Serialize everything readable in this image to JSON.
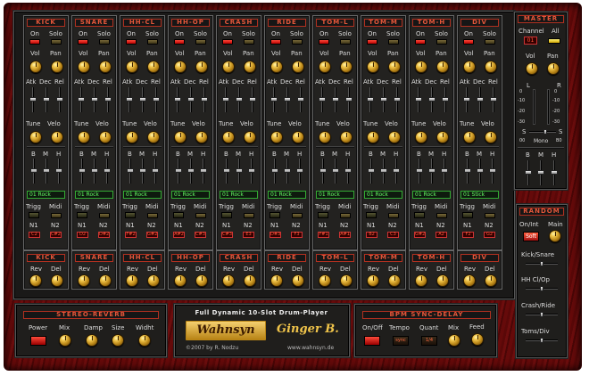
{
  "channels": [
    {
      "name": "KICK",
      "preset": "01 Rock",
      "n1": "C2",
      "n2": "C#2",
      "led_on": "red",
      "led_solo": "dark"
    },
    {
      "name": "SNARE",
      "preset": "01 Rock",
      "n1": "D2",
      "n2": "D#2",
      "led_on": "red",
      "led_solo": "dark"
    },
    {
      "name": "HH-CL",
      "preset": "01 Rock",
      "n1": "F#2",
      "n2": "G#2",
      "led_on": "red",
      "led_solo": "dark"
    },
    {
      "name": "HH-OP",
      "preset": "01 Rock",
      "n1": "A#2",
      "n2": "C#3",
      "led_on": "red",
      "led_solo": "dark"
    },
    {
      "name": "CRASH",
      "preset": "01 Rock",
      "n1": "C#3",
      "n2": "E3",
      "led_on": "red",
      "led_solo": "dark"
    },
    {
      "name": "RIDE",
      "preset": "01 Rock",
      "n1": "D#3",
      "n2": "F3",
      "led_on": "red",
      "led_solo": "dark"
    },
    {
      "name": "TOM-L",
      "preset": "01 Rock",
      "n1": "F#1",
      "n2": "A#1",
      "led_on": "red",
      "led_solo": "dark"
    },
    {
      "name": "TOM-M",
      "preset": "01 Rock",
      "n1": "B2",
      "n2": "C3",
      "led_on": "red",
      "led_solo": "dark"
    },
    {
      "name": "TOM-H",
      "preset": "01 Rock",
      "n1": "G#2",
      "n2": "A2",
      "led_on": "red",
      "led_solo": "dark"
    },
    {
      "name": "DIV",
      "preset": "01 Stick",
      "n1": "F2",
      "n2": "G2",
      "led_on": "red",
      "led_solo": "dark"
    }
  ],
  "labels": {
    "on": "On",
    "solo": "Solo",
    "vol": "Vol",
    "pan": "Pan",
    "atk": "Atk",
    "dec": "Dec",
    "rel": "Rel",
    "tune": "Tune",
    "velo": "Velo",
    "b": "B",
    "m": "M",
    "h": "H",
    "trigg": "Trigg",
    "midi": "Midi",
    "n1": "N1",
    "n2": "N2",
    "rev": "Rev",
    "del": "Del"
  },
  "master": {
    "title": "MASTER",
    "channel": "Channel",
    "all": "All",
    "channel_value": "01",
    "vol": "Vol",
    "pan": "Pan",
    "l": "L",
    "r": "R",
    "db": [
      "0",
      "-10",
      "-20",
      "-30"
    ],
    "s": "S",
    "mono_left": "00",
    "mono": "Mono",
    "mono_right": "B0",
    "b": "B",
    "m": "M",
    "h": "H"
  },
  "random": {
    "title": "RANDOM",
    "onint": "On/Int",
    "main": "Main",
    "soft": "Soft",
    "items": [
      "Kick/Snare",
      "HH Cl/Op",
      "Crash/Ride",
      "Toms/Div"
    ]
  },
  "reverb": {
    "title": "STEREO-REVERB",
    "power": "Power",
    "mix": "Mix",
    "damp": "Damp",
    "size": "Size",
    "width": "Widht"
  },
  "center": {
    "title": "Full Dynamic 10-Slot Drum-Player",
    "brand": "Wahnsyn",
    "product": "Ginger B.",
    "copyright": "©2007 by R. Nodzu",
    "url": "www.wahnsyn.de"
  },
  "delay": {
    "title": "BPM SYNC-DELAY",
    "onoff": "On/Off",
    "tempo": "Tempo",
    "quant": "Quant",
    "mix": "Mix",
    "feed": "Feed",
    "quant_value": "1/4",
    "tempo_value": "sync"
  },
  "colors": {
    "accent_red": "#e4573a",
    "knob_gold": "#f0c44a",
    "lcd_green": "#6f6",
    "wood": "#5a0808"
  }
}
